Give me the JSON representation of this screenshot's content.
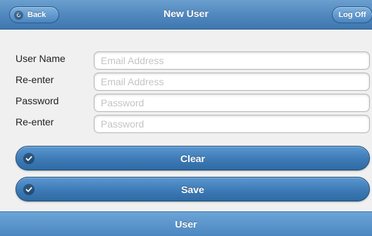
{
  "header": {
    "title": "New User",
    "back_label": "Back",
    "logoff_label": "Log Off"
  },
  "form": {
    "rows": [
      {
        "label": "User Name",
        "value": "",
        "placeholder": "Email Address"
      },
      {
        "label": "Re-enter",
        "value": "",
        "placeholder": "Email Address"
      },
      {
        "label": "Password",
        "value": "",
        "placeholder": "Password"
      },
      {
        "label": "Re-enter",
        "value": "",
        "placeholder": "Password"
      }
    ]
  },
  "actions": {
    "clear_label": "Clear",
    "save_label": "Save"
  },
  "footer": {
    "label": "User"
  },
  "icons": {
    "back": "back-arrow-icon",
    "check": "check-icon"
  },
  "colors": {
    "header": "#4f86bd",
    "button": "#3d7ab6",
    "background": "#f0f0f0"
  }
}
